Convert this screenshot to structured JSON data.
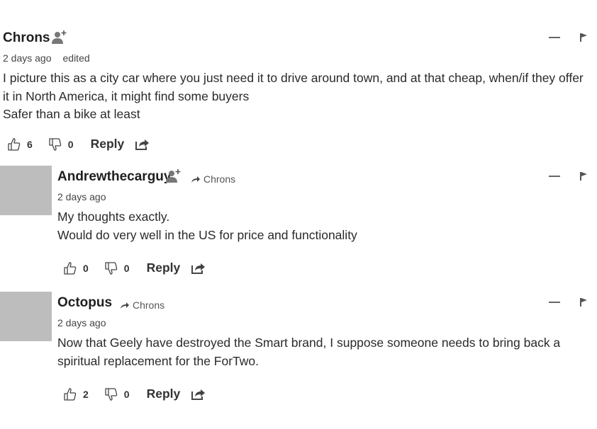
{
  "comments": [
    {
      "author": "Chrons",
      "time": "2 days ago",
      "edited": "edited",
      "lines": [
        "I picture this as a city car where you just need it to drive around town, and at that cheap, when/if they offer it in North America, it might find some buyers",
        "Safer than a bike at least"
      ],
      "likes": "6",
      "dislikes": "0",
      "reply_label": "Reply"
    },
    {
      "author": "Andrewthecarguy",
      "reply_to": "Chrons",
      "time": "2 days ago",
      "lines": [
        "My thoughts exactly.",
        "Would do very well in the US for price and functionality"
      ],
      "likes": "0",
      "dislikes": "0",
      "reply_label": "Reply"
    },
    {
      "author": "Octopus",
      "reply_to": "Chrons",
      "time": "2 days ago",
      "lines": [
        "Now that Geely have destroyed the Smart brand, I suppose someone needs to bring back a spiritual replacement for the ForTwo."
      ],
      "likes": "2",
      "dislikes": "0",
      "reply_label": "Reply"
    }
  ],
  "icons": {
    "follow": "user-plus-icon",
    "reply_arrow": "reply-arrow-icon",
    "collapse": "minus-icon",
    "flag": "flag-icon",
    "like": "thumbs-up-icon",
    "dislike": "thumbs-down-icon",
    "share": "share-icon"
  }
}
